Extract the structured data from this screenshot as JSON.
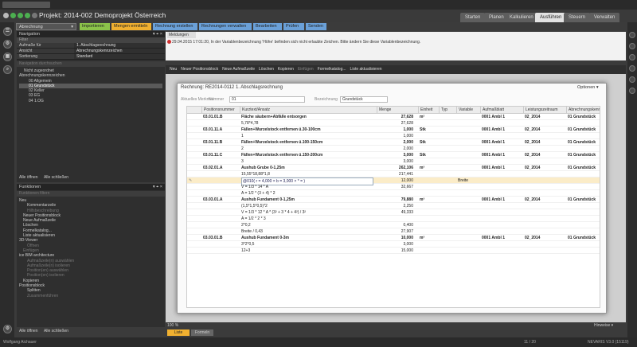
{
  "window_title": "",
  "header": {
    "project_title": "Projekt: 2014-002 Demoprojekt Österreich",
    "tabs": [
      "Starten",
      "Planen",
      "Kalkulieren",
      "Ausführen",
      "Steuern",
      "Verwalten"
    ],
    "active_tab": "Ausführen"
  },
  "function_row": {
    "dropdown": "Abrechnung",
    "buttons": [
      {
        "label": "Importieren",
        "color": "#8bc34a"
      },
      {
        "label": "Mengen ermitteln",
        "color": "#f0b030"
      },
      {
        "label": "Rechnung erstellen",
        "color": "#6aa0d8"
      },
      {
        "label": "Rechnungen verwalten",
        "color": "#6aa0d8"
      },
      {
        "label": "Bearbeiten",
        "color": "#6aa0d8"
      },
      {
        "label": "Prüfen",
        "color": "#6aa0d8"
      },
      {
        "label": "Senden",
        "color": "#6aa0d8"
      }
    ]
  },
  "navigation": {
    "title": "Navigation",
    "filter_label": "Filter",
    "props": [
      {
        "k": "Aufmaße für",
        "v": "1. Abschlagsrechnung"
      },
      {
        "k": "Ansicht",
        "v": "Abrechnungskennzeichen"
      },
      {
        "k": "Sortierung",
        "v": "Standard"
      }
    ],
    "search_placeholder": "Navigation durchsuchen",
    "tree": [
      {
        "label": "Nicht zugeordnet",
        "indent": 1
      },
      {
        "label": "Abrechnungskennzeichen",
        "indent": 0
      },
      {
        "label": "00 Allgemein",
        "indent": 2
      },
      {
        "label": "01 Grundstück",
        "indent": 2
      },
      {
        "label": "02 Keller",
        "indent": 2
      },
      {
        "label": "03 EG",
        "indent": 2
      },
      {
        "label": "04 1.OG",
        "indent": 2
      }
    ],
    "open_all": "Alle öffnen",
    "close_all": "Alle schließen"
  },
  "funktionen": {
    "title": "Funktionen",
    "search_placeholder": "Funktionen filtern",
    "items": [
      {
        "label": "Neu",
        "indent": 0,
        "disabled": false
      },
      {
        "label": "Kommentarzeile",
        "indent": 2,
        "disabled": false
      },
      {
        "label": "Hilfsbeschreibung",
        "indent": 2,
        "disabled": true
      },
      {
        "label": "Neuer Positionsblock",
        "indent": 1,
        "disabled": false
      },
      {
        "label": "Neue Aufmaßzeile",
        "indent": 1,
        "disabled": false
      },
      {
        "label": "Löschen",
        "indent": 1,
        "disabled": false
      },
      {
        "label": "Formelkatalog...",
        "indent": 1,
        "disabled": false
      },
      {
        "label": "Liste aktualisieren",
        "indent": 1,
        "disabled": false
      },
      {
        "label": "3D-Viewer",
        "indent": 0,
        "disabled": false
      },
      {
        "label": "Öffnen",
        "indent": 2,
        "disabled": true
      },
      {
        "label": "Einfügen",
        "indent": 1,
        "disabled": true
      },
      {
        "label": "ice BIM architecture",
        "indent": 0,
        "disabled": false
      },
      {
        "label": "Aufmaßzeile(n) auswählen",
        "indent": 2,
        "disabled": true
      },
      {
        "label": "Aufmaßzeile(n) isolieren",
        "indent": 2,
        "disabled": true
      },
      {
        "label": "Position(en) auswählen",
        "indent": 2,
        "disabled": true
      },
      {
        "label": "Position(en) isolieren",
        "indent": 2,
        "disabled": true
      },
      {
        "label": "Kopieren",
        "indent": 1,
        "disabled": false
      },
      {
        "label": "Positionsblock",
        "indent": 0,
        "disabled": false
      },
      {
        "label": "Splitten",
        "indent": 2,
        "disabled": false
      },
      {
        "label": "Zusammenführen",
        "indent": 2,
        "disabled": true
      }
    ],
    "open_all": "Alle öffnen",
    "close_all": "Alle schließen"
  },
  "meldungen": {
    "tab": "Meldungen",
    "message": "29.04.2015 17:01:20, In der Variablenbezeichnung 'Höhe' befinden sich nicht erlaubte Zeichen. Bitte ändern Sie diese Variablenbezeichnung."
  },
  "toolbar": [
    "Neu",
    "Neuer Positionsblock",
    "Neue Aufmaßzeile",
    "Löschen",
    "Kopieren",
    "Einfügen",
    "Formelkatalog...",
    "Liste aktualisieren"
  ],
  "dialog": {
    "title": "Rechnung: RE2014-0112 1. Abschlagsrechnung",
    "options": "Optionen",
    "field_akz_label": "Aktuelles Merkmal",
    "field_nummer_label": "Nummer",
    "field_nummer_value": "01",
    "field_bez_label": "Bezeichnung",
    "field_bez_value": "Grundstück",
    "columns": [
      "Positionsnummer",
      "Kurztext/Ansatz",
      "Menge",
      "Einheit",
      "Typ",
      "Variable",
      "Aufmaßblatt",
      "Leistungszeitraum",
      "Abrechnungskennz...",
      "K"
    ],
    "rows": [
      {
        "pos": "03.01.01.B",
        "text": "Fläche säubern+Abfälle entsorgen",
        "menge": "27,628",
        "einheit": "m²",
        "blatt": "0001 Ambl 1",
        "zeitraum": "02_2014",
        "akz": "01 Grundstück",
        "k": "M",
        "type": "pos"
      },
      {
        "pos": "",
        "text": "5,78*4,78",
        "menge": "27,628",
        "type": "sub"
      },
      {
        "pos": "03.01.11.A",
        "text": "Fällen+Wurzelstock entfernen ü.30-100cm",
        "menge": "1,000",
        "einheit": "Stk",
        "blatt": "0001 Ambl 1",
        "zeitraum": "02_2014",
        "akz": "01 Grundstück",
        "k": "M",
        "type": "pos"
      },
      {
        "pos": "",
        "text": "1",
        "menge": "1,000",
        "type": "sub"
      },
      {
        "pos": "03.01.11.B",
        "text": "Fällen+Wurzelstock entfernen ü.100-150cm",
        "menge": "2,000",
        "einheit": "Stk",
        "blatt": "0001 Ambl 1",
        "zeitraum": "02_2014",
        "akz": "01 Grundstück",
        "k": "M",
        "type": "pos"
      },
      {
        "pos": "",
        "text": "2",
        "menge": "2,000",
        "type": "sub"
      },
      {
        "pos": "03.01.11.C",
        "text": "Fällen+Wurzelstock entfernen ü.150-200cm",
        "menge": "3,000",
        "einheit": "Stk",
        "blatt": "0001 Ambl 1",
        "zeitraum": "02_2014",
        "akz": "01 Grundstück",
        "k": "M",
        "type": "pos"
      },
      {
        "pos": "",
        "text": "3",
        "menge": "3,000",
        "type": "sub"
      },
      {
        "pos": "03.02.01.A",
        "text": "Aushub Grube 0-1,25m",
        "menge": "262,106",
        "einheit": "m³",
        "blatt": "0001 Ambl 1",
        "zeitraum": "02_2014",
        "akz": "01 Grundstück",
        "k": "M",
        "type": "pos"
      },
      {
        "pos": "",
        "text": "15,55*18,88*1,8",
        "menge": "217,441",
        "type": "sub"
      },
      {
        "pos": "",
        "text": "@010( r = 4,000 × b = 3,000 × * = )",
        "menge": "12,000",
        "variable": "Breite",
        "type": "sel"
      },
      {
        "pos": "",
        "text": "V = 1/3 * 14 * A",
        "menge": "32,667",
        "type": "sub"
      },
      {
        "pos": "",
        "text": "A = 1/2 * (3 + 4) * 2",
        "menge": "",
        "type": "sub"
      },
      {
        "pos": "03.03.01.A",
        "text": "Aushub Fundament 0-1,25m",
        "menge": "79,880",
        "einheit": "m³",
        "blatt": "0001 Ambl 1",
        "zeitraum": "02_2014",
        "akz": "01 Grundstück",
        "k": "M",
        "type": "pos"
      },
      {
        "pos": "",
        "text": "(1,5*1,5*0,5)*2",
        "menge": "2,250",
        "type": "sub"
      },
      {
        "pos": "",
        "text": "V = 1/3 * 12 * A * (3² + 3 * 4 + 4²) / 3²",
        "menge": "49,333",
        "type": "sub"
      },
      {
        "pos": "",
        "text": "A = 1/2 * 2 * 3",
        "menge": "",
        "type": "sub"
      },
      {
        "pos": "",
        "text": "2*0,2",
        "menge": "0,400",
        "type": "sub"
      },
      {
        "pos": "",
        "text": "Breite / 0,43",
        "menge": "27,907",
        "type": "sub"
      },
      {
        "pos": "03.03.01.B",
        "text": "Aushub Fundament 0-3m",
        "menge": "10,000",
        "einheit": "m³",
        "blatt": "0001 Ambl 1",
        "zeitraum": "02_2014",
        "akz": "01 Grundstück",
        "k": "M",
        "type": "pos"
      },
      {
        "pos": "",
        "text": "3*2*0,5",
        "menge": "3,000",
        "type": "sub"
      },
      {
        "pos": "",
        "text": "12+3",
        "menge": "15,000",
        "type": "sub"
      }
    ]
  },
  "bottom": {
    "zoom": "100 %",
    "tab_liste": "Liste",
    "tab_2": "Formeln",
    "hinweise": "Hinweise"
  },
  "status": {
    "user": "Wolfgang Aichauer",
    "page": "11 / 20",
    "version": "NEVARIS V3.0 (15119)"
  }
}
